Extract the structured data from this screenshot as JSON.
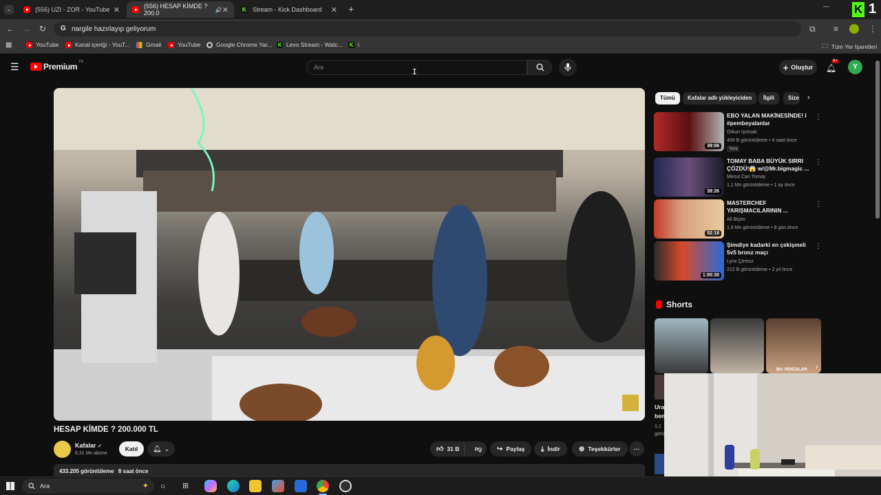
{
  "browser": {
    "tabs": [
      {
        "title": "(556) UZI - ZOR - YouTube",
        "active": false
      },
      {
        "title": "(556) HESAP KİMDE ? 200.0",
        "active": true
      },
      {
        "title": "Stream - Kick Dashboard",
        "active": false
      }
    ],
    "new_tab": "+",
    "window_controls": {
      "minimize": "—"
    },
    "address": "nargile hazırlayıp geliyorum",
    "bookmarks": [
      "YouTube",
      "Kanal içeriği - YouT...",
      "Gmail",
      "YouTube",
      "Google Chrome Yar...",
      "Levo Stream - Watc...",
      "i"
    ],
    "bookmarks_other": "Tüm Yer İşaretleri",
    "overlay_badge": "1"
  },
  "youtube": {
    "logo": "Premium",
    "logo_sup": "TR",
    "search_placeholder": "Ara",
    "create_label": "Oluştur",
    "notif_count": "9+",
    "avatar_letter": "Y",
    "chips": [
      "Tümü",
      "Kafalar adlı yükleyiciden",
      "İlgili",
      "Size"
    ],
    "recommendations": [
      {
        "title": "EBO YALAN MAKİNESİNDE! I #pembeyalanlar",
        "channel": "Orkun Işıtmak",
        "meta": "409 B görüntüleme • 4 saat önce",
        "duration": "39:06",
        "badge": "Yeni"
      },
      {
        "title": "TOMAY BABA BÜYÜK SIRRI ÇÖZDÜ!😱 w/@Mr.bigmagic ...",
        "channel": "Mesut Can Tomay",
        "meta": "1,1 Mn görüntüleme • 1 ay önce",
        "duration": "39:26"
      },
      {
        "title": "MASTERCHEF YARIŞMACILARININ ...",
        "channel": "Ali Biçim",
        "meta": "1,6 Mn görüntüleme • 8 gün önce",
        "duration": "52:18"
      },
      {
        "title": "Şimdiye kadarki en çekişmeli 5v5 bronz maçı",
        "channel": "Lynx Çerezz",
        "meta": "212 B görüntüleme • 2 yıl önce",
        "duration": "1:00:30"
      }
    ],
    "shorts_heading": "Shorts",
    "shorts_label": "BU VIDEOLAR",
    "shorts_peek": {
      "title": "Ura",
      "title2": "ben",
      "views": "1,1",
      "ago": "görü"
    },
    "video": {
      "title": "HESAP KİMDE ? 200.000 TL",
      "channel": "Kafalar",
      "subscribers": "8,31 Mn abone",
      "join": "Katıl",
      "likes": "31 B",
      "share": "Paylaş",
      "download": "İndir",
      "thanks": "Teşekkürler",
      "views": "433.205 görüntüleme",
      "ago": "8 saat önce"
    }
  },
  "taskbar": {
    "search_label": "Ara"
  },
  "colors": {
    "yt_red": "#ff0000",
    "kick_green": "#53fc18",
    "background": "#0f0f0f"
  }
}
